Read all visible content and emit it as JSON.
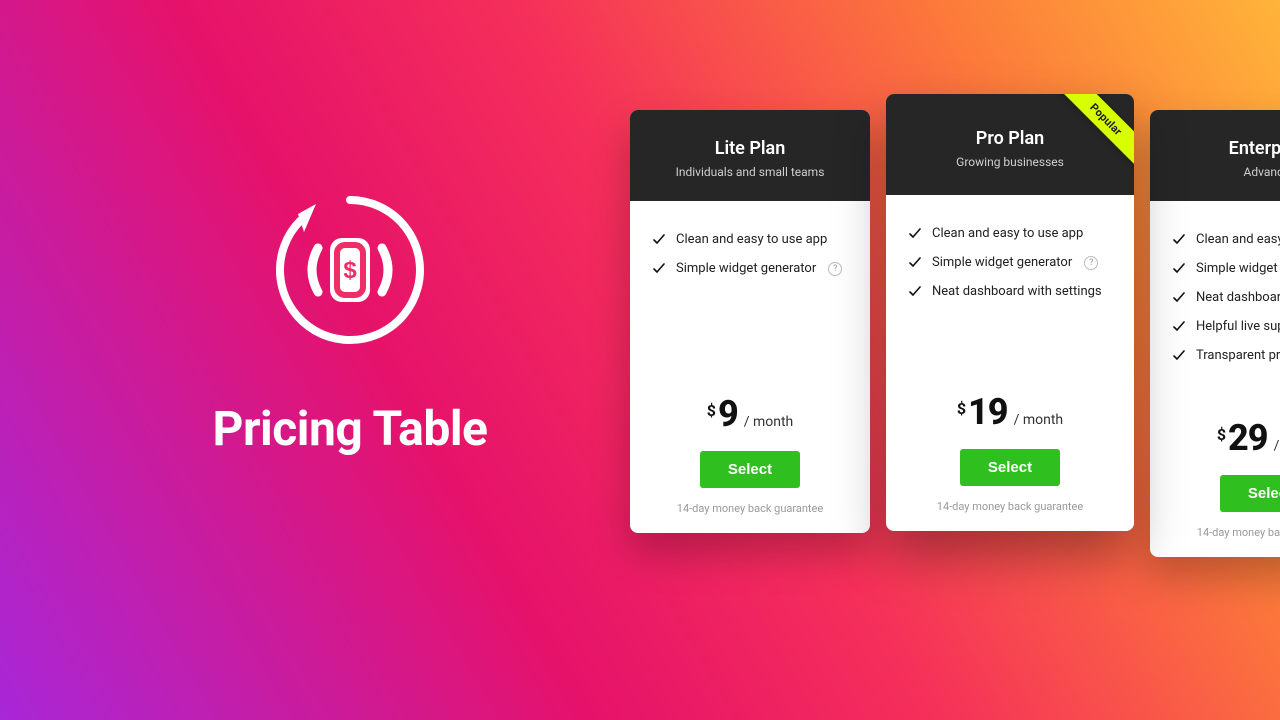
{
  "hero": {
    "title": "Pricing Table"
  },
  "ribbon_label": "Popular",
  "common": {
    "currency": "$",
    "period": "/ month",
    "cta": "Select",
    "note": "14-day money back guarantee",
    "help_glyph": "?"
  },
  "features_pool": [
    "Clean and easy to use app",
    "Simple widget generator",
    "Neat dashboard with settings",
    "Helpful live support",
    "Transparent pricing"
  ],
  "plans": [
    {
      "id": "lite",
      "name": "Lite Plan",
      "subtitle": "Individuals and small teams",
      "price": "9",
      "features": [
        {
          "text_ref": 0,
          "help": false
        },
        {
          "text_ref": 1,
          "help": true
        }
      ]
    },
    {
      "id": "pro",
      "name": "Pro Plan",
      "subtitle": "Growing businesses",
      "price": "19",
      "popular": true,
      "features": [
        {
          "text_ref": 0,
          "help": false
        },
        {
          "text_ref": 1,
          "help": true
        },
        {
          "text_ref": 2,
          "help": false
        }
      ]
    },
    {
      "id": "enterprise",
      "name": "Enterprise",
      "subtitle": "Advanced",
      "price": "29",
      "features": [
        {
          "text_ref": 0,
          "help": false
        },
        {
          "text_ref": 1,
          "help": false
        },
        {
          "text_ref": 2,
          "help": false
        },
        {
          "text_ref": 3,
          "help": false
        },
        {
          "text_ref": 4,
          "help": false
        }
      ]
    }
  ]
}
